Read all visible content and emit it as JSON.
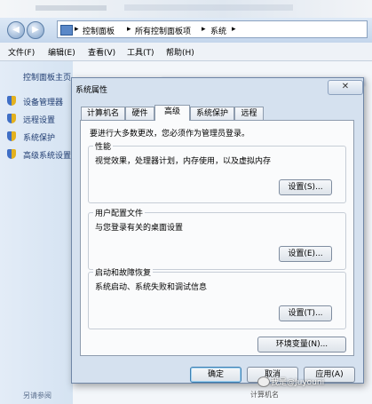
{
  "explorer": {
    "address": [
      "控制面板",
      "所有控制面板项",
      "系统"
    ],
    "menu": [
      "文件(F)",
      "编辑(E)",
      "查看(V)",
      "工具(T)",
      "帮助(H)"
    ],
    "left_title": "控制面板主页",
    "left_items": [
      "设备管理器",
      "远程设置",
      "系统保护",
      "高级系统设置"
    ],
    "left_footer": "另请参阅",
    "right_footer": "计算机名"
  },
  "dialog": {
    "title": "系统属性",
    "close": "✕",
    "tabs": [
      "计算机名",
      "硬件",
      "高级",
      "系统保护",
      "远程"
    ],
    "active_tab": "高级",
    "note": "要进行大多数更改，您必须作为管理员登录。",
    "groups": [
      {
        "label": "性能",
        "desc": "视觉效果，处理器计划，内存使用，以及虚拟内存",
        "button": "设置(S)..."
      },
      {
        "label": "用户配置文件",
        "desc": "与您登录有关的桌面设置",
        "button": "设置(E)..."
      },
      {
        "label": "启动和故障恢复",
        "desc": "系统启动、系统失败和调试信息",
        "button": "设置(T)..."
      }
    ],
    "env_button": "环境变量(N)...",
    "ok": "确定",
    "cancel": "取消",
    "apply": "应用(A)"
  },
  "watermark": "我是@Juyouni"
}
